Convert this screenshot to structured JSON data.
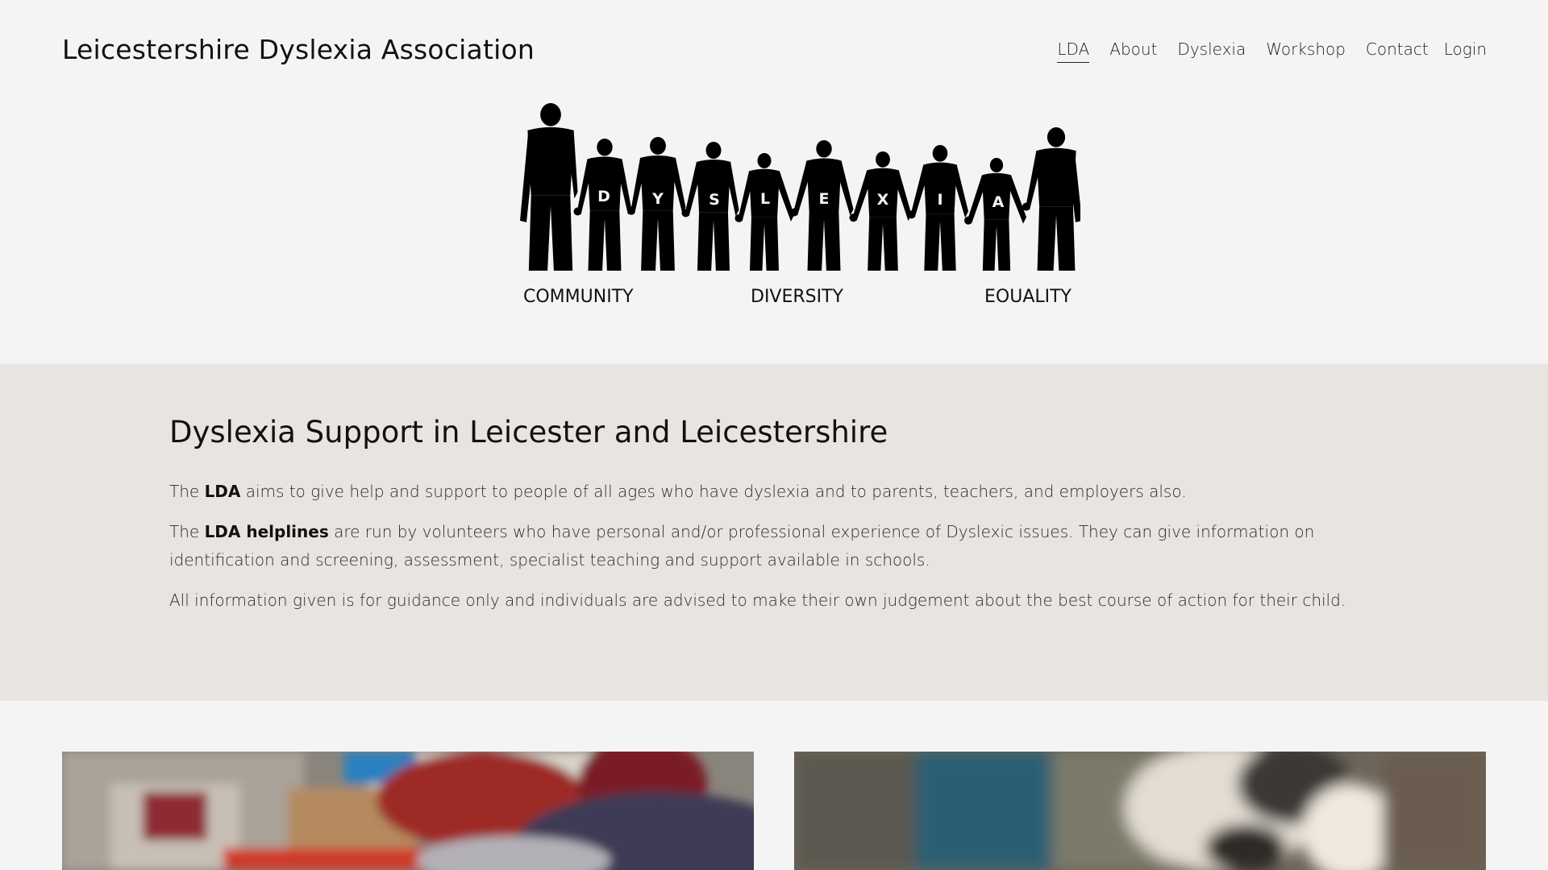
{
  "header": {
    "site_title": "Leicestershire Dyslexia Association",
    "nav": [
      {
        "label": "LDA",
        "active": true
      },
      {
        "label": "About"
      },
      {
        "label": "Dyslexia"
      },
      {
        "label": "Workshop"
      },
      {
        "label": "Contact"
      },
      {
        "label": "Login"
      }
    ]
  },
  "logo": {
    "letters": [
      "D",
      "Y",
      "S",
      "L",
      "E",
      "X",
      "I",
      "A"
    ],
    "captions": [
      "COMMUNITY",
      "DIVERSITY",
      "EOUALITY"
    ]
  },
  "intro": {
    "title": "Dyslexia Support in Leicester and Leicestershire",
    "p1_prefix": "The ",
    "p1_bold": "LDA",
    "p1_rest": " aims to give help and support to people of all ages who have dyslexia and to parents, teachers, and employers also.",
    "p2_prefix": "The ",
    "p2_bold": "LDA helplines",
    "p2_rest": " are run by volunteers who have personal and/or professional experience of Dyslexic issues.  They can give information on identification and screening, assessment, specialist teaching and support available in schools.",
    "p3": "All information given is for guidance only and individuals are advised to make their own judgement about the best course of action for their child."
  },
  "colors": {
    "page_bg": "#f4f4f4",
    "band_bg": "#e8e5e1",
    "text": "#1a1a1a"
  }
}
